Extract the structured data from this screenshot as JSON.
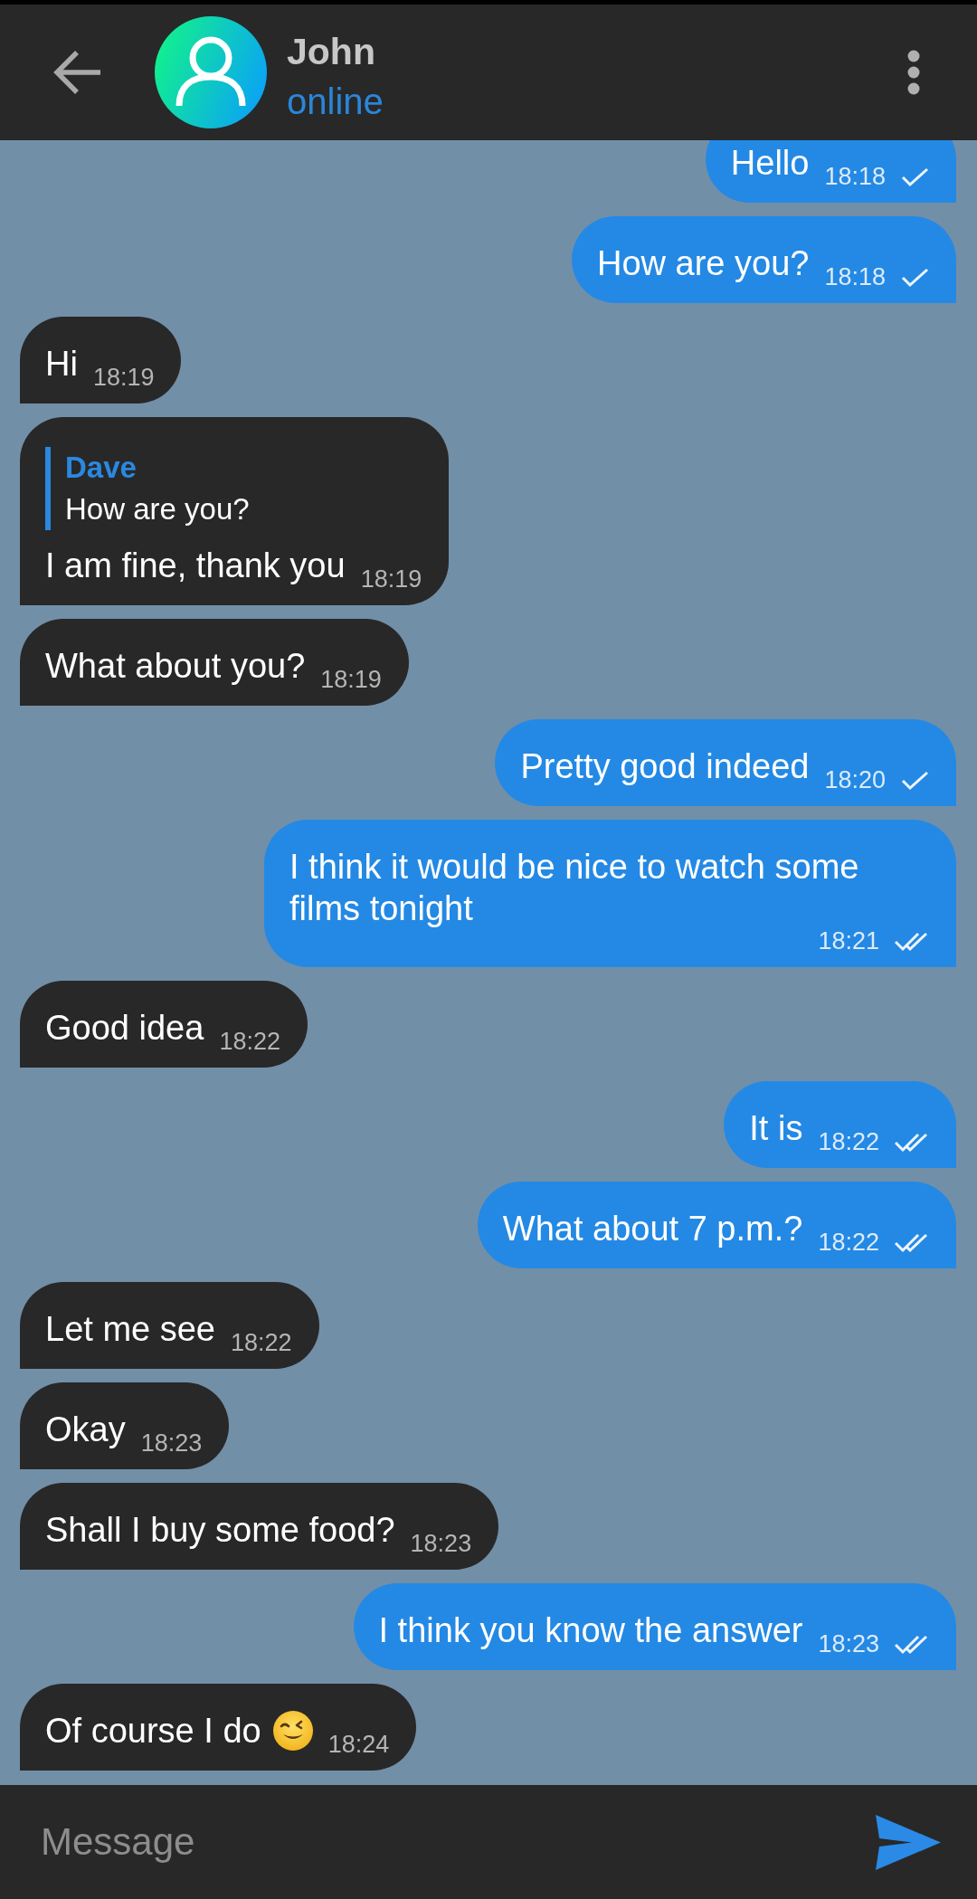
{
  "header": {
    "name": "John",
    "status": "online"
  },
  "messages": [
    {
      "kind": "outgoing",
      "text": "Hello",
      "time": "18:18",
      "read": false
    },
    {
      "kind": "outgoing",
      "text": "How are you?",
      "time": "18:18",
      "read": false
    },
    {
      "kind": "incoming",
      "text": "Hi",
      "time": "18:19"
    },
    {
      "kind": "incoming",
      "text": "I am fine, thank you",
      "time": "18:19",
      "reply": {
        "author": "Dave",
        "text": "How are you?"
      }
    },
    {
      "kind": "incoming",
      "text": "What about you?",
      "time": "18:19"
    },
    {
      "kind": "outgoing",
      "text": "Pretty good indeed",
      "time": "18:20",
      "read": false
    },
    {
      "kind": "outgoing",
      "text": "I think it would be nice to watch some films tonight",
      "time": "18:21",
      "read": true
    },
    {
      "kind": "incoming",
      "text": "Good idea",
      "time": "18:22"
    },
    {
      "kind": "outgoing",
      "text": "It is",
      "time": "18:22",
      "read": true
    },
    {
      "kind": "outgoing",
      "text": "What about 7 p.m.?",
      "time": "18:22",
      "read": true
    },
    {
      "kind": "incoming",
      "text": "Let me see",
      "time": "18:22"
    },
    {
      "kind": "incoming",
      "text": "Okay",
      "time": "18:23"
    },
    {
      "kind": "incoming",
      "text": "Shall I buy some food?",
      "time": "18:23"
    },
    {
      "kind": "outgoing",
      "text": "I think you know the answer",
      "time": "18:23",
      "read": true
    },
    {
      "kind": "incoming",
      "text": "Of course I do",
      "time": "18:24",
      "emoji": {
        "kind": "wink"
      }
    }
  ],
  "composer": {
    "placeholder": "Message"
  }
}
